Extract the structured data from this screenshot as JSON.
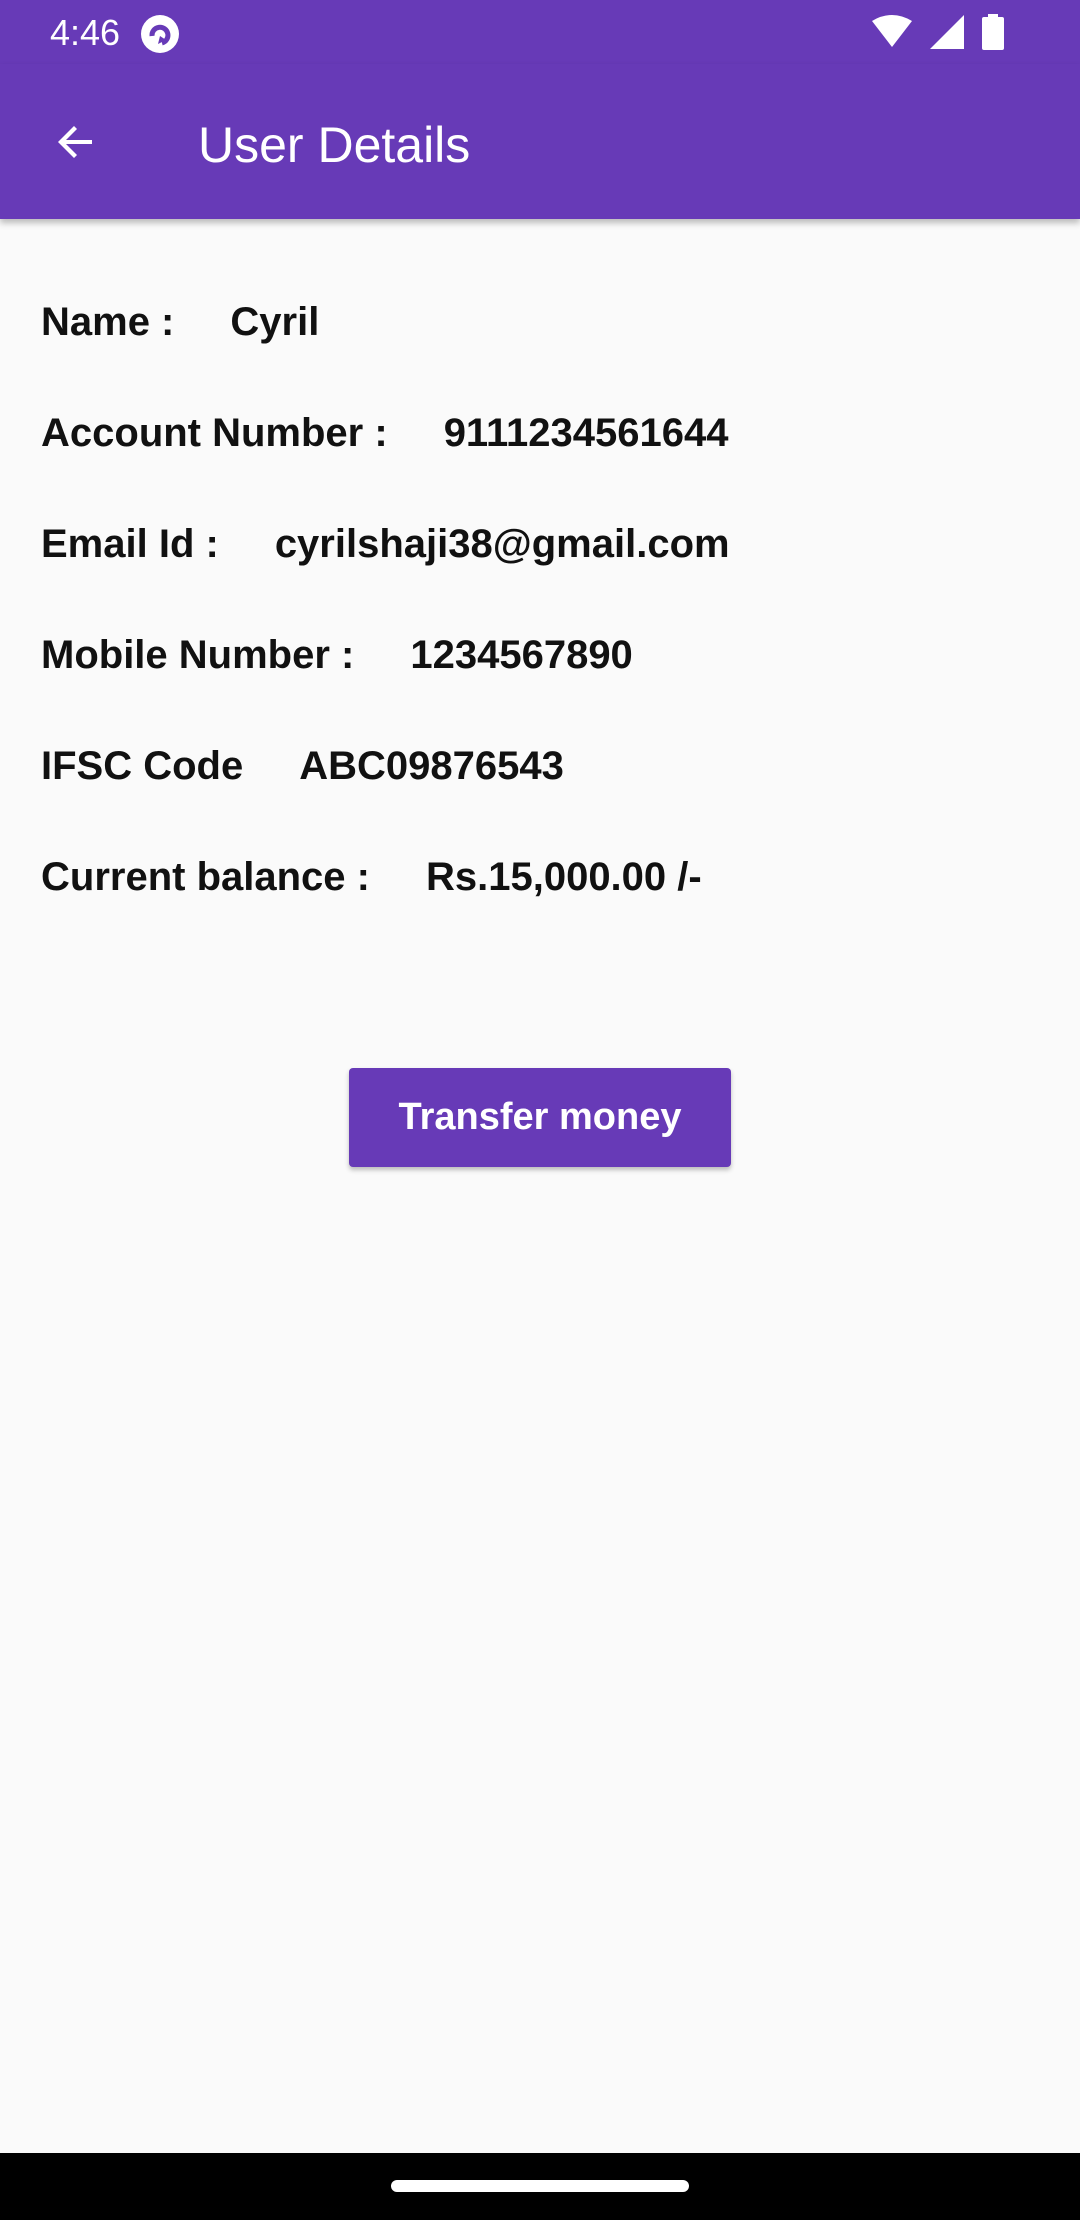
{
  "status_bar": {
    "time": "4:46",
    "icons": [
      "app-notification-icon",
      "wifi-icon",
      "cellular-icon",
      "battery-icon"
    ]
  },
  "app_bar": {
    "title": "User Details",
    "back_icon": "arrow-back-icon",
    "color": "#673ab7"
  },
  "details": {
    "name": {
      "label": "Name :",
      "value": "Cyril"
    },
    "account_number": {
      "label": "Account Number :",
      "value": "9111234561644"
    },
    "email": {
      "label": "Email Id :",
      "value": "cyrilshaji38@gmail.com"
    },
    "mobile": {
      "label": "Mobile Number :",
      "value": "1234567890"
    },
    "ifsc": {
      "label": "IFSC Code",
      "value": "ABC09876543"
    },
    "balance": {
      "label": "Current balance :",
      "value": "Rs.15,000.00 /-"
    }
  },
  "actions": {
    "transfer_label": "Transfer money"
  }
}
